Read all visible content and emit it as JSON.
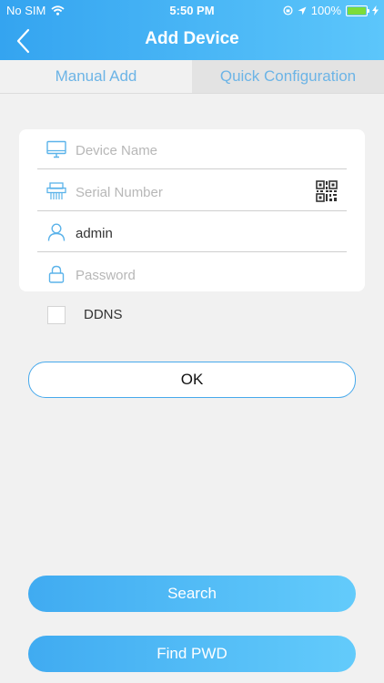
{
  "status_bar": {
    "carrier": "No SIM",
    "time": "5:50 PM",
    "battery_pct": "100%"
  },
  "nav": {
    "title": "Add Device",
    "back_icon": "chevron-left-icon"
  },
  "tabs": [
    {
      "label": "Manual Add",
      "active": true
    },
    {
      "label": "Quick Configuration",
      "active": false
    }
  ],
  "form": {
    "device_name": {
      "placeholder": "Device Name",
      "value": "",
      "icon": "monitor-icon"
    },
    "serial_number": {
      "placeholder": "Serial Number",
      "value": "",
      "icon": "shredder-icon",
      "action_icon": "qr-code-icon"
    },
    "username": {
      "placeholder": "",
      "value": "admin",
      "icon": "user-icon"
    },
    "password": {
      "placeholder": "Password",
      "value": "",
      "icon": "lock-icon"
    }
  },
  "ddns": {
    "label": "DDNS",
    "checked": false
  },
  "buttons": {
    "ok": "OK",
    "search": "Search",
    "find_pwd": "Find PWD"
  },
  "colors": {
    "accent": "#3fa9f5",
    "header_start": "#34a4f0",
    "header_end": "#5cc6fb",
    "tab_text": "#6cb4e6"
  }
}
